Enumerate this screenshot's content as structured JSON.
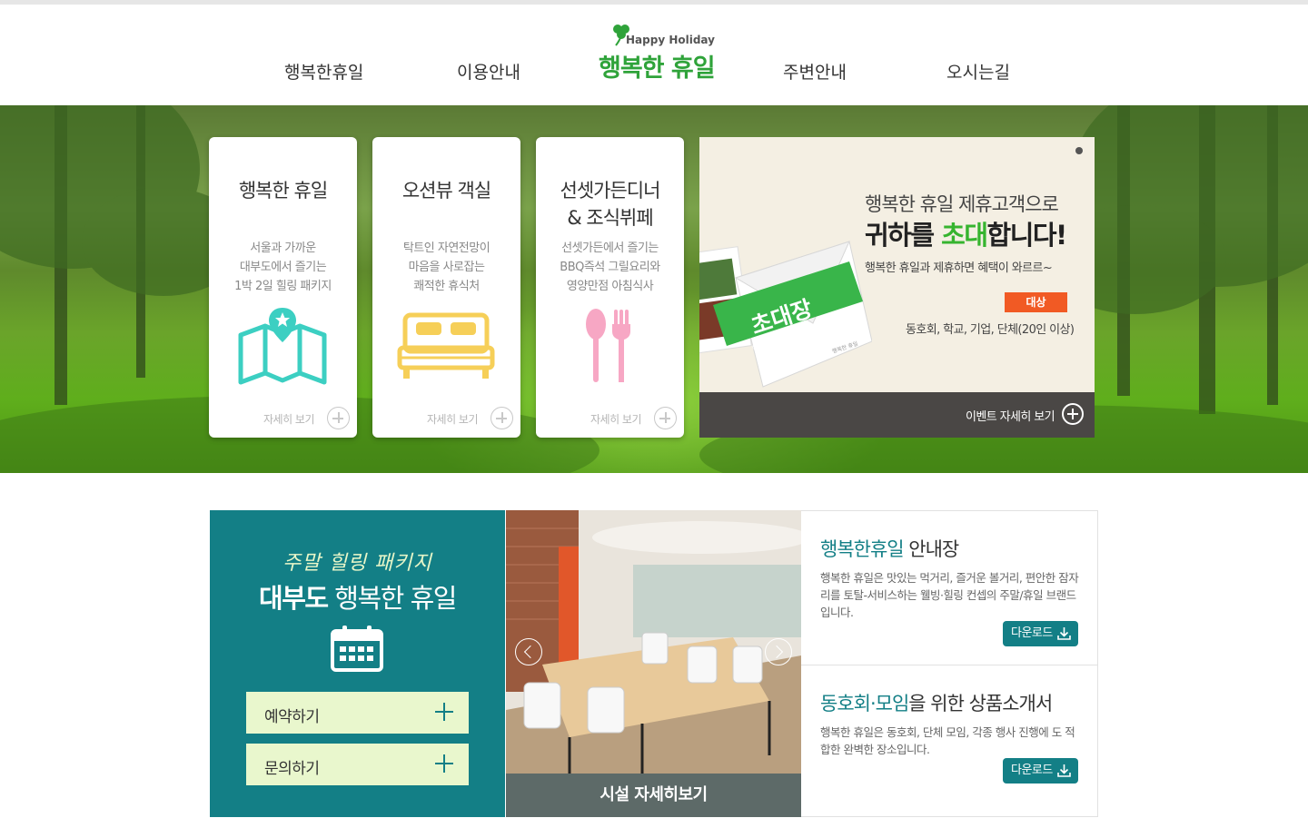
{
  "header": {
    "logo": {
      "tagline": "Happy Holiday",
      "name": "행복한 휴일"
    },
    "nav": [
      "행복한휴일",
      "이용안내",
      "주변안내",
      "오시는길"
    ]
  },
  "hero": {
    "cards": [
      {
        "title": "행복한 휴일",
        "desc": [
          "서울과 가까운",
          "대부도에서 즐기는",
          "1박 2일 힐링 패키지"
        ],
        "icon": "map-icon",
        "more": "자세히 보기"
      },
      {
        "title": "오션뷰 객실",
        "desc": [
          "탁트인 자연전망이",
          "마음을 사로잡는",
          "쾌적한 휴식처"
        ],
        "icon": "bed-icon",
        "more": "자세히 보기"
      },
      {
        "title_line1": "선셋가든디너",
        "title_line2": "& 조식뷔페",
        "desc": [
          "선셋가든에서 즐기는",
          "BBQ즉석 그릴요리와",
          "영양만점 아침식사"
        ],
        "icon": "spoon-fork-icon",
        "more": "자세히 보기"
      }
    ],
    "promo": {
      "line1": "행복한 휴일 제휴고객으로",
      "line2_a": "귀하를 ",
      "line2_hl": "초대",
      "line2_b": "합니다!",
      "line3": "행복한 휴일과 제휴하면 혜택이 와르르~",
      "badge": "대상",
      "targets": "동호회, 학교, 기업, 단체(20인 이상)",
      "invite_label": "초대장",
      "invite_small": "행복한 휴일 제휴고객으로 귀하를 초대",
      "envelope_brand": "행복한 휴일",
      "more": "이벤트 자세히 보기"
    },
    "colors": {
      "accent_green": "#36b42f",
      "badge_orange": "#f15a24"
    }
  },
  "package": {
    "sub": "주말 힐링 패키지",
    "main_bold": "대부도",
    "main_rest": " 행복한 휴일",
    "buttons": [
      "예약하기",
      "문의하기"
    ],
    "colors": {
      "teal": "#137f86",
      "button_bg": "#e9f7cd"
    }
  },
  "facility": {
    "caption": "시설 자세히보기"
  },
  "info": [
    {
      "title_hl": "행복한휴일",
      "title_rest": " 안내장",
      "desc": "행복한 휴일은 맛있는 먹거리, 즐거운 볼거리, 편안한 잠자리를 토탈-서비스하는 웰빙·힐링 컨셉의 주말/휴일 브랜드 입니다.",
      "download": "다운로드"
    },
    {
      "title_hl": "동호회·모임",
      "title_rest": "을 위한 상품소개서",
      "desc": "행복한 휴일은 동호회, 단체 모임, 각종 행사 진행에 도 적합한 완벽한 장소입니다.",
      "download": "다운로드"
    }
  ]
}
